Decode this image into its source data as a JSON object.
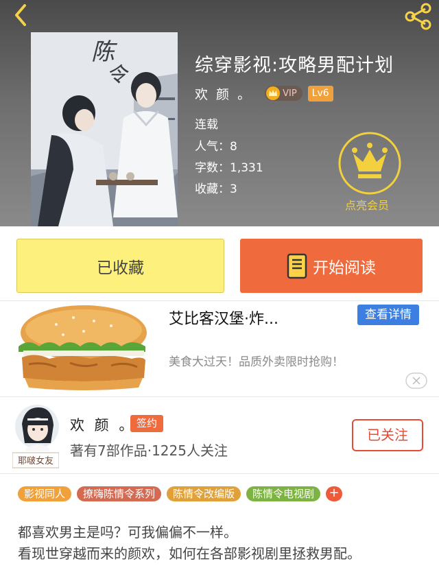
{
  "book": {
    "title": "综穿影视:攻略男配计划",
    "author": "欢 颜 。",
    "vip_label": "VIP",
    "level": "Lv6",
    "status": "连载",
    "popularity": "人气：8",
    "word_count": "字数：1,331",
    "favorites": "收藏：3",
    "cover_alt": "book-cover"
  },
  "member": {
    "label": "点亮会员"
  },
  "actions": {
    "collect_label": "已收藏",
    "read_label": "开始阅读"
  },
  "ad": {
    "title": "艾比客汉堡·炸...",
    "detail_label": "查看详情",
    "description": "美食大过天！品质外卖限时抢购！"
  },
  "author_card": {
    "name": "欢 颜 。",
    "signed_label": "签约",
    "stats": "著有7部作品·1225人关注",
    "follow_label": "已关注",
    "avatar_badge": "耶啵女友"
  },
  "tags": [
    {
      "label": "影视同人",
      "color": "#f0a13c"
    },
    {
      "label": "撩嗨陈情令系列",
      "color": "#d46a52"
    },
    {
      "label": "陈情令改编版",
      "color": "#e0a03a"
    },
    {
      "label": "陈情令电视剧",
      "color": "#7cb342"
    }
  ],
  "tag_more": "+",
  "intro": {
    "line1": "都喜欢男主是吗？可我偏偏不一样。",
    "line2": "看现世穿越而来的颜欢，如何在各部影视剧里拯救男配。"
  },
  "colors": {
    "accent_orange": "#ef6a3d",
    "collect_yellow": "#fdf07d",
    "detail_blue": "#3d7fe0",
    "crown_yellow": "#f3d03e"
  },
  "icons": {
    "back": "back-arrow-icon",
    "share": "share-icon",
    "book": "book-icon",
    "crown": "crown-icon",
    "close": "close-icon"
  }
}
